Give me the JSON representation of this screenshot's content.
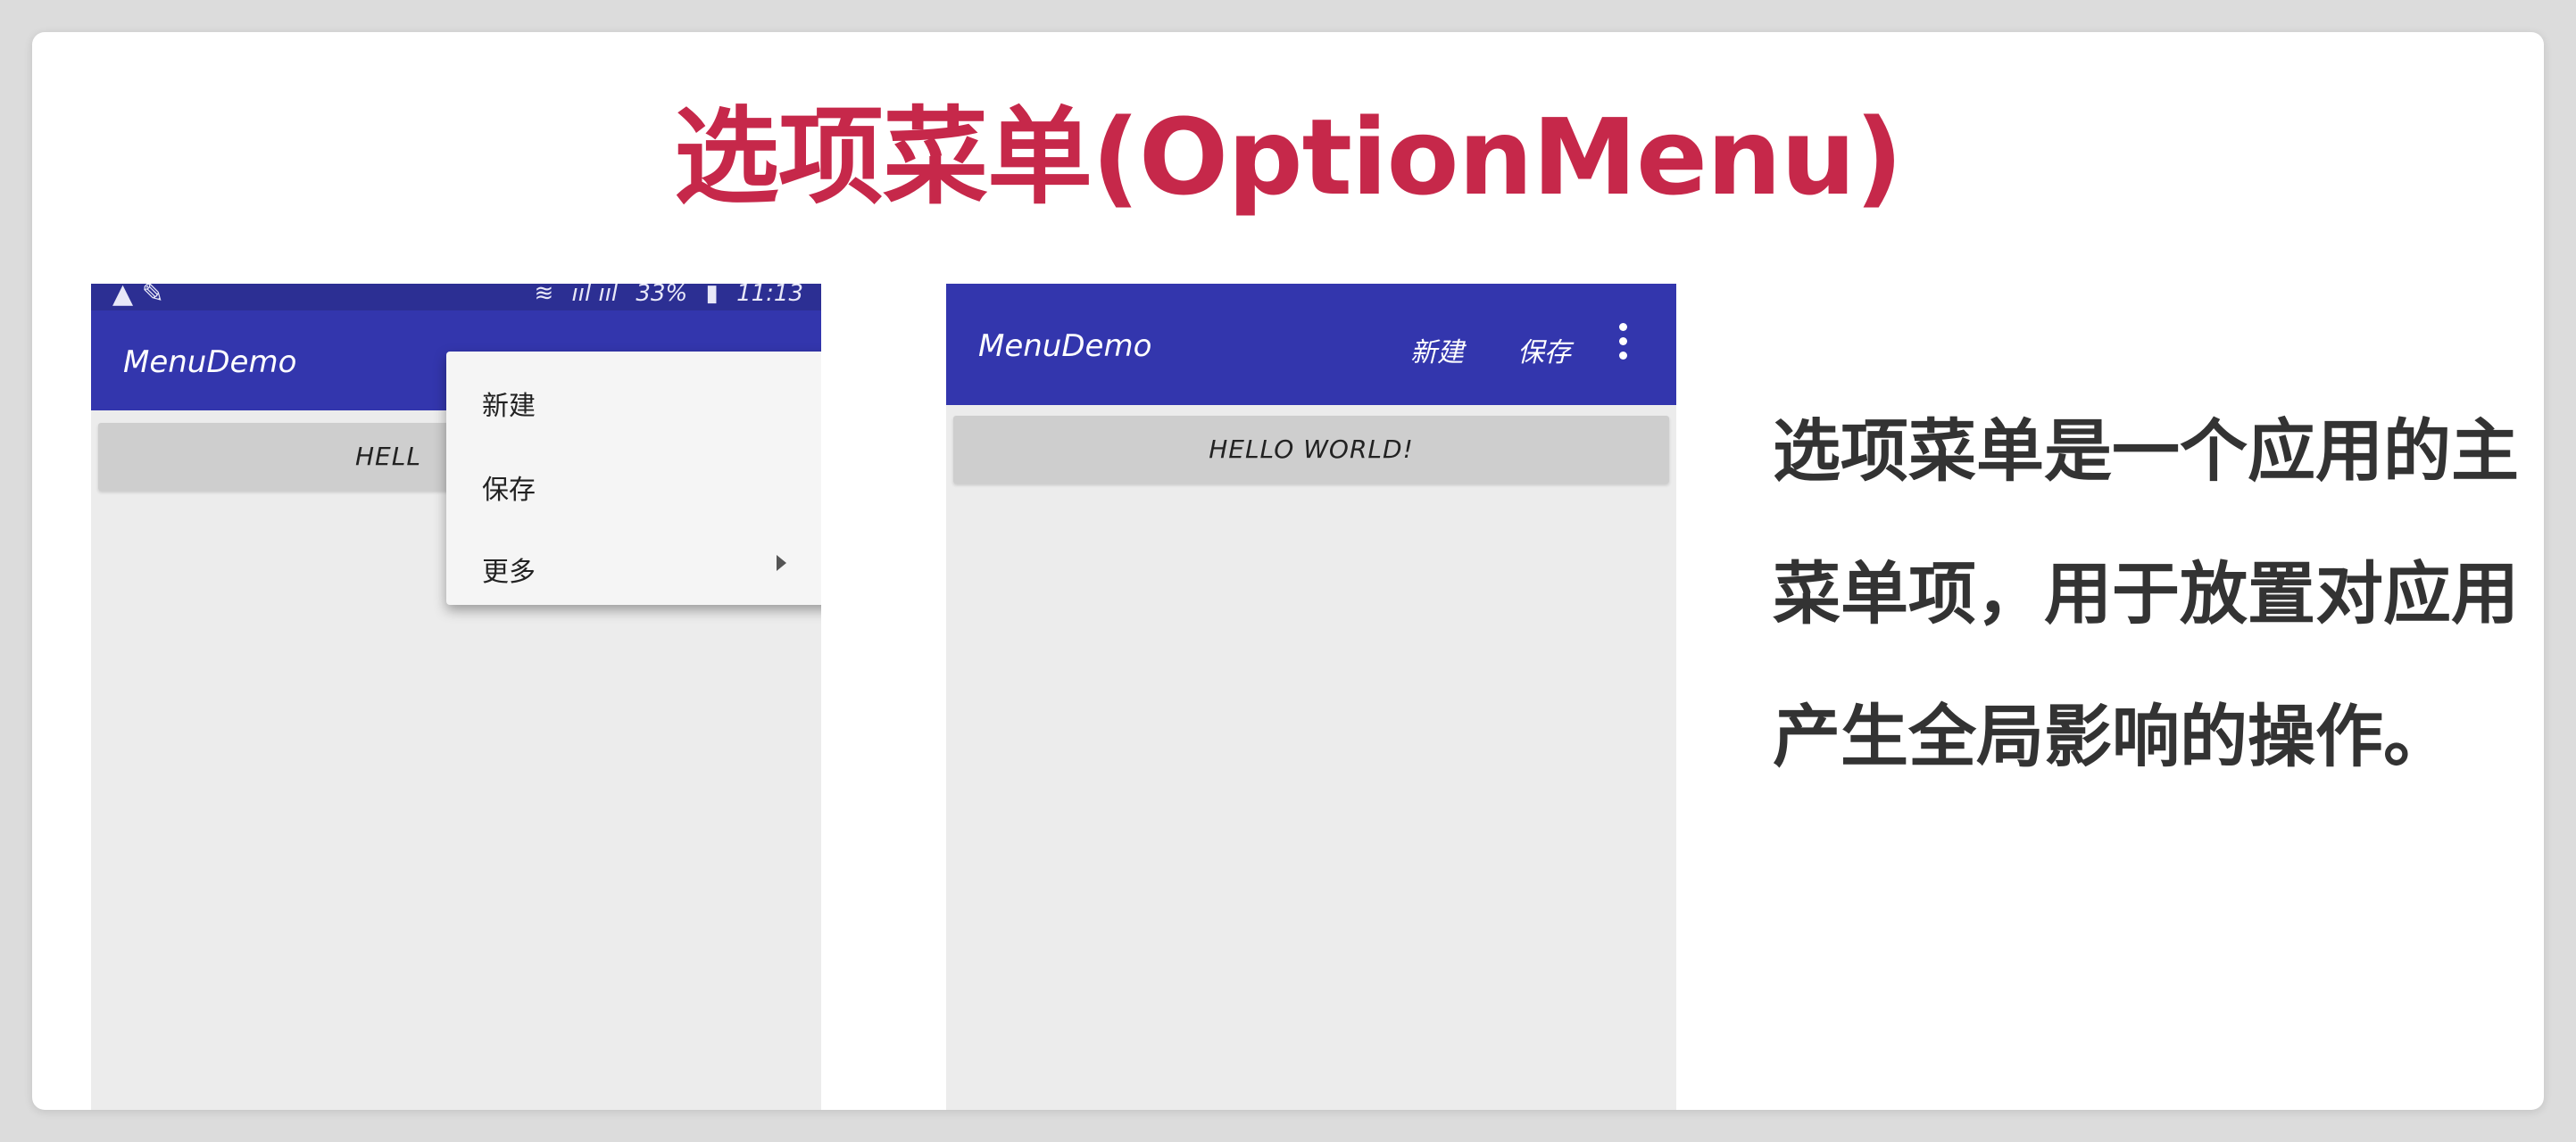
{
  "slide": {
    "title": "选项菜单(OptionMenu)",
    "description": "选项菜单是一个应用的主菜单项，用于放置对应用产生全局影响的操作。"
  },
  "phone_left": {
    "status_bar": {
      "left_icons": "▲ ✎",
      "battery": "33%",
      "time": "11:13"
    },
    "app_title": "MenuDemo",
    "hello_text": "HELL",
    "popup_menu": {
      "items": [
        {
          "label": "新建"
        },
        {
          "label": "保存"
        },
        {
          "label": "更多",
          "has_submenu": true
        }
      ]
    }
  },
  "phone_right": {
    "app_title": "MenuDemo",
    "actions": {
      "new_label": "新建",
      "save_label": "保存"
    },
    "overflow_icon": "more-vert-icon",
    "hello_text": "HELLO WORLD!"
  },
  "colors": {
    "title_red": "#c6284a",
    "app_bar": "#3336ad",
    "status_bar": "#2c2f93",
    "body_text": "#333333"
  }
}
